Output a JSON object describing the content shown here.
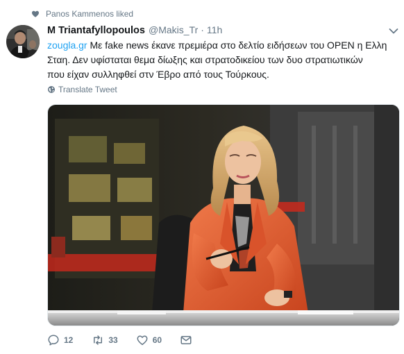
{
  "context": {
    "liked_by": "Panos Kammenos liked"
  },
  "tweet": {
    "author_name": "M Triantafyllopoulos",
    "handle": "@Makis_Tr",
    "separator": "·",
    "time": "11h",
    "link_text": "zougla.gr",
    "text_1": " Με fake news έκανε πρεμιέρα στο δελτίο ειδήσεων του OPEN η Ελλη",
    "text_2": "Σταη. Δεν υφίσταται θεμα δίωξης και στρατοδικείου των δυο στρατιωτικών",
    "text_3": "που είχαν συλληφθεί στν Έβρο από τους Τούρκους.",
    "translate_label": "Translate Tweet"
  },
  "actions": {
    "replies": "12",
    "retweets": "33",
    "likes": "60"
  },
  "icons": {
    "heart": "heart-icon",
    "globe": "globe-icon",
    "reply": "reply-icon",
    "retweet": "retweet-icon",
    "like": "like-icon",
    "message": "envelope-icon",
    "caret": "chevron-down-icon"
  },
  "colors": {
    "link": "#1da1f2",
    "secondary_text": "#657786",
    "primary_text": "#14171a"
  }
}
